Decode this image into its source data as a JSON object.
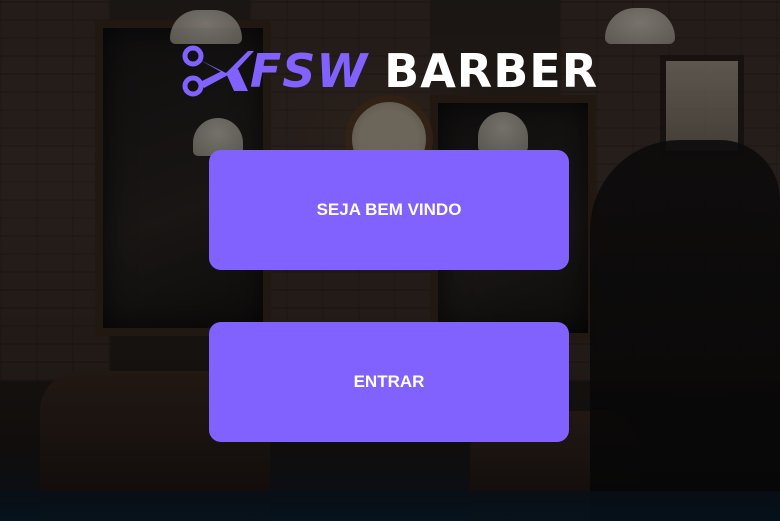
{
  "theme": {
    "accent": "#8162ff",
    "text_on_accent": "#ffffff"
  },
  "logo": {
    "icon": "scissors-icon",
    "brand_part_1": "FSW",
    "brand_part_2": "BARBER"
  },
  "buttons": {
    "welcome_label": "SEJA BEM VINDO",
    "enter_label": "ENTRAR"
  }
}
